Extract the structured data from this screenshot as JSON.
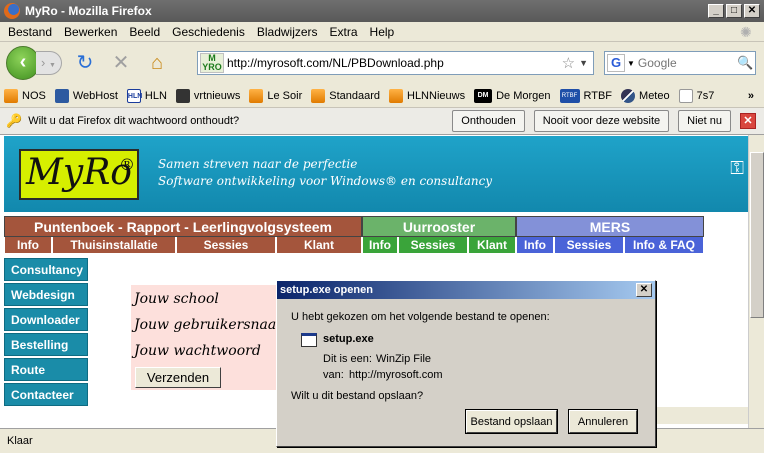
{
  "window": {
    "title": "MyRo - Mozilla Firefox"
  },
  "menu": [
    "Bestand",
    "Bewerken",
    "Beeld",
    "Geschiedenis",
    "Bladwijzers",
    "Extra",
    "Help"
  ],
  "nav": {
    "url": "http://myrosoft.com/NL/PBDownload.php",
    "site_icon_text": "M YRO",
    "search_engine_letter": "G",
    "search_placeholder": "Google"
  },
  "bookmarks": [
    "NOS",
    "WebHost",
    "HLN",
    "vrtnieuws",
    "Le Soir",
    "Standaard",
    "HLNNieuws",
    "De Morgen",
    "RTBF",
    "Meteo",
    "7s7"
  ],
  "bookmark_icon_labels": {
    "hln": "HLN",
    "demorgen": "DM",
    "rtbf": "RTBF"
  },
  "notification": {
    "message": "Wilt u dat Firefox dit wachtwoord onthoudt?",
    "buttons": [
      "Onthouden",
      "Nooit voor deze website",
      "Niet nu"
    ]
  },
  "site": {
    "logo": "MyRo",
    "logo_mark": "®",
    "tagline_line1": "Samen streven naar de perfectie",
    "tagline_line2": "Software ontwikkeling voor Windows® en consultancy",
    "sections": [
      {
        "title": "Puntenboek - Rapport - Leerlingvolgsysteem",
        "items": [
          "Info",
          "Thuisinstallatie",
          "Sessies",
          "Klant"
        ]
      },
      {
        "title": "Uurrooster",
        "items": [
          "Info",
          "Sessies",
          "Klant"
        ]
      },
      {
        "title": "MERS",
        "items": [
          "Info",
          "Sessies",
          "Info & FAQ"
        ]
      }
    ],
    "sidebar": [
      "Consultancy",
      "Webdesign",
      "Downloader",
      "Bestelling",
      "Route",
      "Contacteer"
    ],
    "login": {
      "school_label": "Jouw school",
      "user_label": "Jouw gebruikersnaam",
      "password_label": "Jouw wachtwoord",
      "submit": "Verzenden"
    }
  },
  "status": {
    "text": "Klaar"
  },
  "dialog": {
    "title": "setup.exe openen",
    "intro": "U hebt gekozen om het volgende bestand te openen:",
    "filename": "setup.exe",
    "type_label": "Dit is een:",
    "type_value": "WinZip File",
    "from_label": "van:",
    "from_value": "http://myrosoft.com",
    "question": "Wilt u dit bestand opslaan?",
    "save_button": "Bestand opslaan",
    "cancel_button": "Annuleren"
  }
}
